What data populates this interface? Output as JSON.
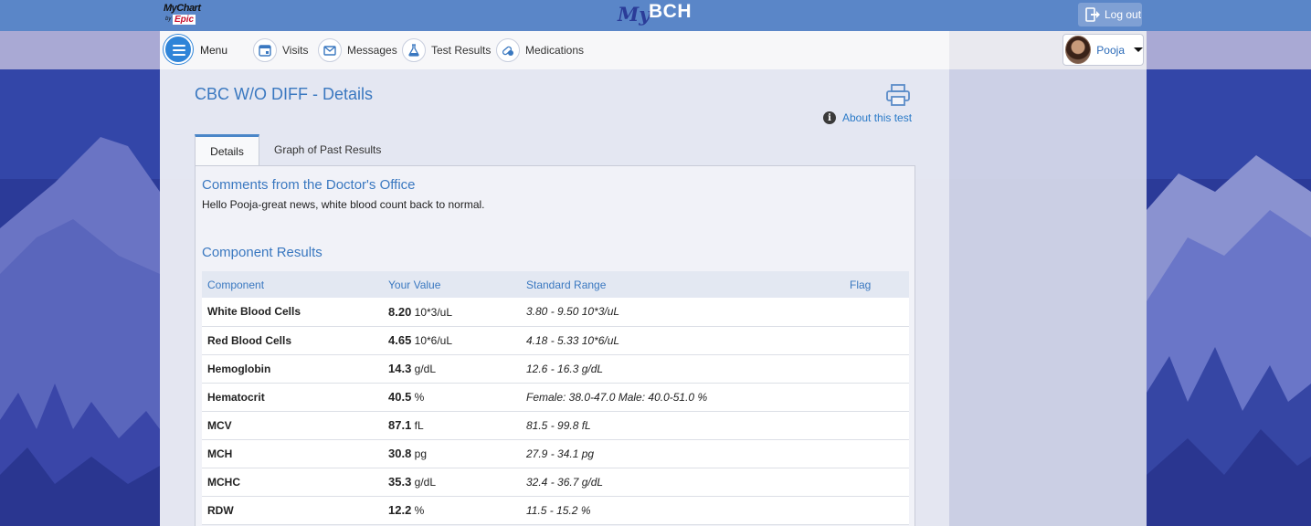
{
  "header": {
    "mychart_logo": "MyChart",
    "mychart_by": "by",
    "epic_logo": "Epic",
    "brand_my": "My",
    "brand_bch": "BCH",
    "logout_label": "Log out"
  },
  "nav": {
    "menu_label": "Menu",
    "items": [
      {
        "label": "Visits",
        "icon": "calendar-icon"
      },
      {
        "label": "Messages",
        "icon": "envelope-icon"
      },
      {
        "label": "Test Results",
        "icon": "flask-icon"
      },
      {
        "label": "Medications",
        "icon": "pills-icon"
      }
    ],
    "user_name": "Pooja"
  },
  "page": {
    "title": "CBC W/O DIFF - Details",
    "about_link": "About this test",
    "tabs": [
      {
        "label": "Details",
        "active": true
      },
      {
        "label": "Graph of Past Results",
        "active": false
      }
    ],
    "comments_title": "Comments from the Doctor's Office",
    "comment_text": "Hello Pooja-great news, white blood count back to normal.",
    "results_title": "Component Results",
    "columns": [
      "Component",
      "Your Value",
      "Standard Range",
      "Flag"
    ],
    "rows": [
      {
        "component": "White Blood Cells",
        "value": "8.20",
        "unit": "10*3/uL",
        "range": "3.80 - 9.50 10*3/uL",
        "flag": ""
      },
      {
        "component": "Red Blood Cells",
        "value": "4.65",
        "unit": "10*6/uL",
        "range": "4.18 - 5.33 10*6/uL",
        "flag": ""
      },
      {
        "component": "Hemoglobin",
        "value": "14.3",
        "unit": "g/dL",
        "range": "12.6 - 16.3 g/dL",
        "flag": ""
      },
      {
        "component": "Hematocrit",
        "value": "40.5",
        "unit": "%",
        "range": "Female: 38.0-47.0 Male: 40.0-51.0 %",
        "flag": ""
      },
      {
        "component": "MCV",
        "value": "87.1",
        "unit": "fL",
        "range": "81.5 - 99.8 fL",
        "flag": ""
      },
      {
        "component": "MCH",
        "value": "30.8",
        "unit": "pg",
        "range": "27.9 - 34.1 pg",
        "flag": ""
      },
      {
        "component": "MCHC",
        "value": "35.3",
        "unit": "g/dL",
        "range": "32.4 - 36.7 g/dL",
        "flag": ""
      },
      {
        "component": "RDW",
        "value": "12.2",
        "unit": "%",
        "range": "11.5 - 15.2 %",
        "flag": ""
      }
    ]
  },
  "colors": {
    "header_bg": "#5a86c8",
    "accent_blue": "#3a78c0",
    "menu_button": "#2f84d8",
    "background_deep": "#2a3a96"
  }
}
